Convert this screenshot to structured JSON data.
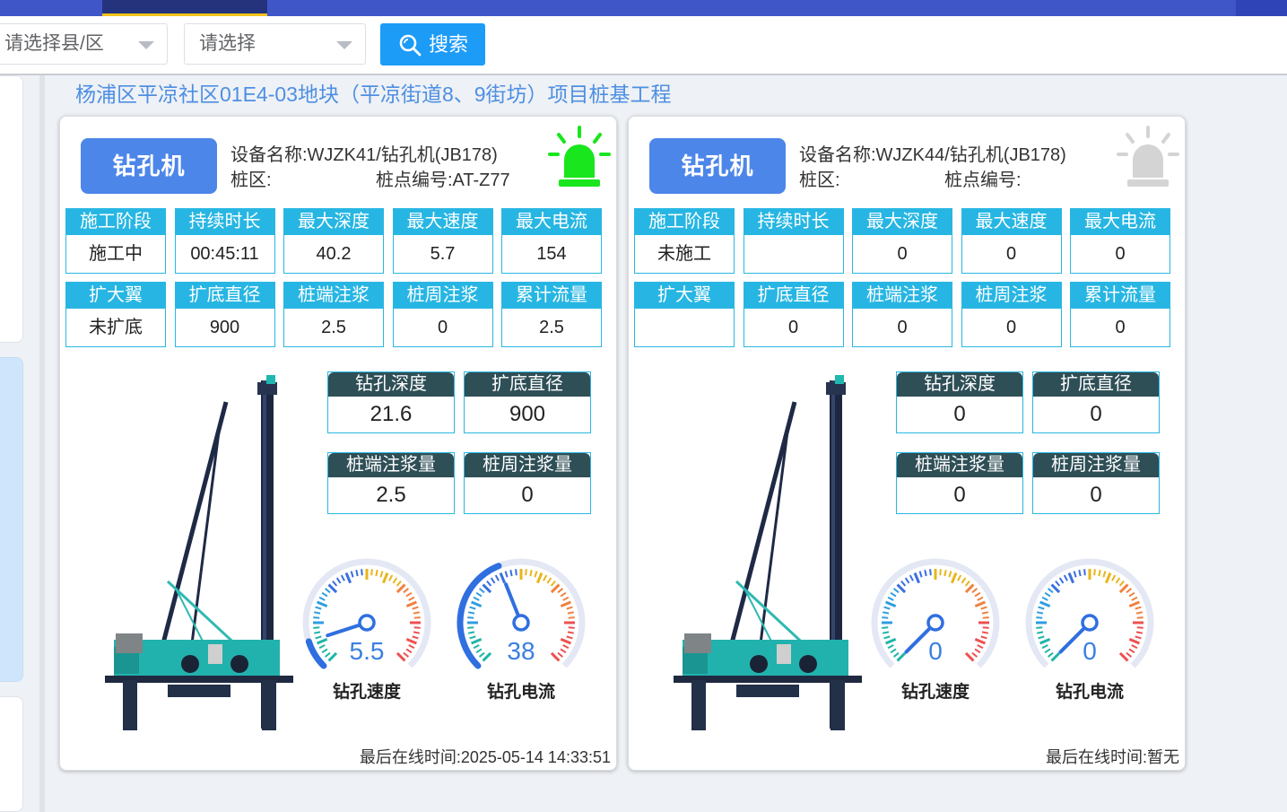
{
  "filters": {
    "district_placeholder": "请选择县/区",
    "second_placeholder": "请选择",
    "search_label": "搜索"
  },
  "project_title": "杨浦区平凉社区01E4-03地块（平凉街道8、9街坊）项目桩基工程",
  "panels": [
    {
      "type_label": "钻孔机",
      "device_name": "设备名称:WJZK41/钻孔机(JB178)",
      "zone": "桩区:",
      "pile_no": "桩点编号:AT-Z77",
      "alarm_color": "#19e61c",
      "cells_row1": [
        {
          "h": "施工阶段",
          "v": "施工中"
        },
        {
          "h": "持续时长",
          "v": "00:45:11"
        },
        {
          "h": "最大深度",
          "v": "40.2"
        },
        {
          "h": "最大速度",
          "v": "5.7"
        },
        {
          "h": "最大电流",
          "v": "154"
        }
      ],
      "cells_row2": [
        {
          "h": "扩大翼",
          "v": "未扩底"
        },
        {
          "h": "扩底直径",
          "v": "900"
        },
        {
          "h": "桩端注浆",
          "v": "2.5"
        },
        {
          "h": "桩周注浆",
          "v": "0"
        },
        {
          "h": "累计流量",
          "v": "2.5"
        }
      ],
      "metrics": [
        {
          "h": "钻孔深度",
          "v": "21.6"
        },
        {
          "h": "扩底直径",
          "v": "900"
        },
        {
          "h": "桩端注浆量",
          "v": "2.5"
        },
        {
          "h": "桩周注浆量",
          "v": "0"
        }
      ],
      "gauges": [
        {
          "value": "5.5",
          "label": "钻孔速度",
          "fraction": 0.1
        },
        {
          "value": "38",
          "label": "钻孔电流",
          "fraction": 0.42
        }
      ],
      "last_online": "最后在线时间:2025-05-14 14:33:51"
    },
    {
      "type_label": "钻孔机",
      "device_name": "设备名称:WJZK44/钻孔机(JB178)",
      "zone": "桩区:",
      "pile_no": "桩点编号:",
      "alarm_color": "#d4d4d4",
      "cells_row1": [
        {
          "h": "施工阶段",
          "v": "未施工"
        },
        {
          "h": "持续时长",
          "v": ""
        },
        {
          "h": "最大深度",
          "v": "0"
        },
        {
          "h": "最大速度",
          "v": "0"
        },
        {
          "h": "最大电流",
          "v": "0"
        }
      ],
      "cells_row2": [
        {
          "h": "扩大翼",
          "v": ""
        },
        {
          "h": "扩底直径",
          "v": "0"
        },
        {
          "h": "桩端注浆",
          "v": "0"
        },
        {
          "h": "桩周注浆",
          "v": "0"
        },
        {
          "h": "累计流量",
          "v": "0"
        }
      ],
      "metrics": [
        {
          "h": "钻孔深度",
          "v": "0"
        },
        {
          "h": "扩底直径",
          "v": "0"
        },
        {
          "h": "桩端注浆量",
          "v": "0"
        },
        {
          "h": "桩周注浆量",
          "v": "0"
        }
      ],
      "gauges": [
        {
          "value": "0",
          "label": "钻孔速度",
          "fraction": 0
        },
        {
          "value": "0",
          "label": "钻孔电流",
          "fraction": 0
        }
      ],
      "last_online": "最后在线时间:暂无"
    }
  ]
}
